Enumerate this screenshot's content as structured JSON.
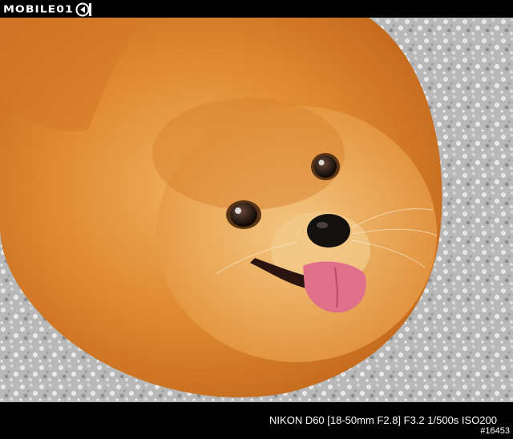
{
  "header": {
    "logo_text": "MOBILE01",
    "logo_icon": "mobile01-logo-mark"
  },
  "photo": {
    "subject_icon": "pomeranian-photo"
  },
  "footer": {
    "exif": "NIKON D60 [18-50mm F2.8] F3.2 1/500s ISO200",
    "photo_id": "#16453"
  },
  "colors": {
    "bar": "#000000",
    "fur": "#e0892f",
    "gravel": "#c9c9c9",
    "tongue": "#e0708a"
  }
}
